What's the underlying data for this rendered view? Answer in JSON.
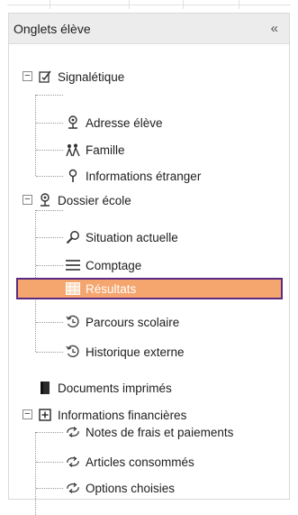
{
  "panel": {
    "title": "Onglets élève",
    "collapse_glyph": "«"
  },
  "tree": [
    {
      "label": "Signalétique",
      "icon": "checklist-icon",
      "level": 0,
      "expanded": true,
      "children": [
        {
          "label": "Adresse élève",
          "icon": "location-pin-icon"
        },
        {
          "label": "Famille",
          "icon": "family-icon"
        },
        {
          "label": "Informations étranger",
          "icon": "map-pin-icon"
        }
      ]
    },
    {
      "label": "Dossier école",
      "icon": "location-pin-icon",
      "level": 0,
      "expanded": true,
      "children": [
        {
          "label": "Situation actuelle",
          "icon": "magnifier-icon"
        },
        {
          "label": "Comptage",
          "icon": "list-icon"
        },
        {
          "label": "Résultats",
          "icon": "grid-icon",
          "selected": true
        },
        {
          "label": "Parcours scolaire",
          "icon": "history-icon"
        },
        {
          "label": "Historique externe",
          "icon": "history-icon"
        }
      ]
    },
    {
      "label": "Documents imprimés",
      "icon": "document-icon",
      "level": 0
    },
    {
      "label": "Informations financières",
      "icon": "plus-box-icon",
      "level": 0,
      "expanded": true,
      "children": [
        {
          "label": "Notes de frais et paiements",
          "icon": "cycle-icon"
        },
        {
          "label": "Articles consommés",
          "icon": "cycle-icon"
        },
        {
          "label": "Options choisies",
          "icon": "cycle-icon"
        }
      ]
    }
  ],
  "colors": {
    "selected_bg": "#f5a66f",
    "selected_border": "#5b2b82",
    "header_bg": "#ececec"
  }
}
